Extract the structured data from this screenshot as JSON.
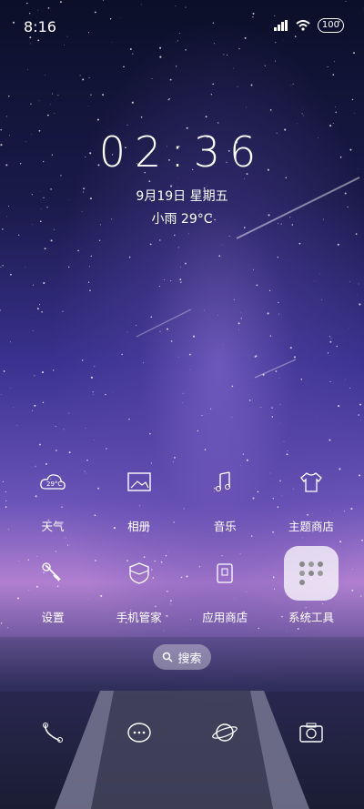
{
  "status": {
    "time": "8:16",
    "battery": "100"
  },
  "lockscreen": {
    "time": "02:36",
    "date": "9月19日 星期五",
    "weather": "小雨 29°C"
  },
  "apps_row1": [
    {
      "label": "天气",
      "icon": "weather-icon"
    },
    {
      "label": "相册",
      "icon": "gallery-icon"
    },
    {
      "label": "音乐",
      "icon": "music-icon"
    },
    {
      "label": "主题商店",
      "icon": "theme-store-icon"
    }
  ],
  "apps_row2": [
    {
      "label": "设置",
      "icon": "settings-icon"
    },
    {
      "label": "手机管家",
      "icon": "phone-manager-icon"
    },
    {
      "label": "应用商店",
      "icon": "app-store-icon"
    },
    {
      "label": "系统工具",
      "icon": "system-tools-folder-icon"
    }
  ],
  "weather_icon_text": "29°C",
  "search": {
    "label": "搜索"
  },
  "dock": [
    {
      "icon": "phone-icon"
    },
    {
      "icon": "messages-icon"
    },
    {
      "icon": "browser-icon"
    },
    {
      "icon": "camera-icon"
    }
  ]
}
